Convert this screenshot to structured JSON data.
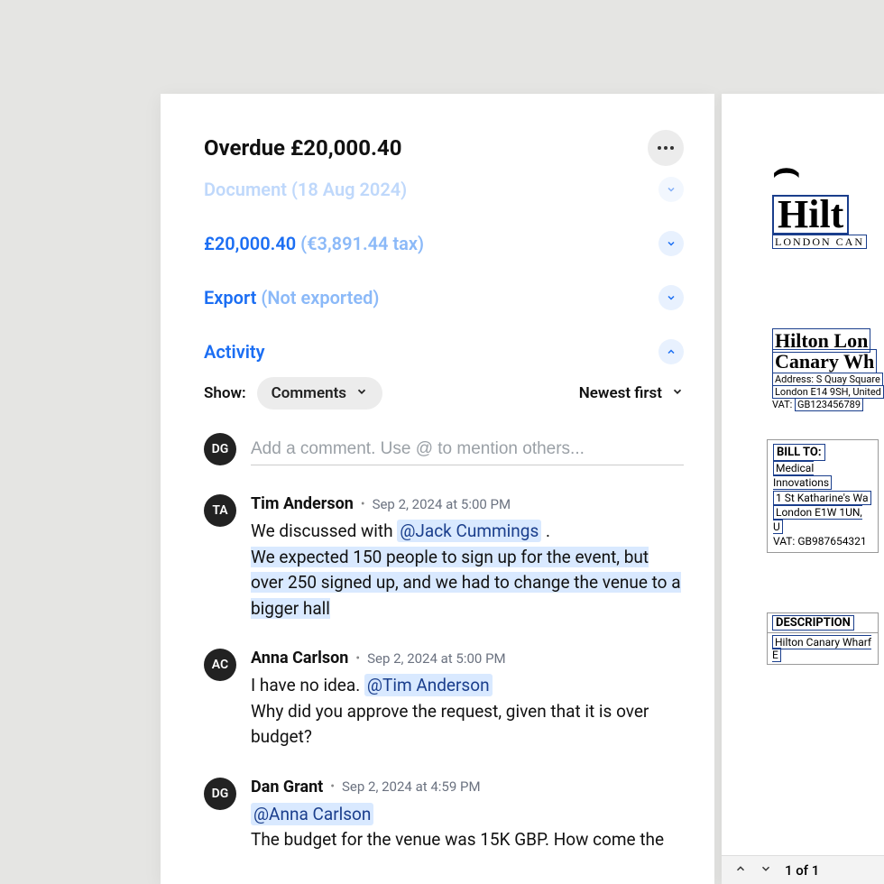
{
  "header": {
    "title": "Overdue £20,000.40"
  },
  "sections": {
    "document": {
      "label": "Document",
      "meta": "(18 Aug 2024)"
    },
    "amount": {
      "label": "£20,000.40",
      "meta": "(€3,891.44 tax)"
    },
    "export": {
      "label": "Export",
      "meta": "(Not exported)"
    },
    "activity": {
      "label": "Activity"
    }
  },
  "filters": {
    "show_label": "Show:",
    "show_value": "Comments",
    "sort": "Newest first"
  },
  "composer": {
    "avatar": "DG",
    "placeholder": "Add a comment. Use @ to mention others..."
  },
  "comments": [
    {
      "avatar": "TA",
      "author": "Tim Anderson",
      "time": "Sep 2, 2024 at 5:00 PM",
      "text_pre": "We discussed with ",
      "mention": "@Jack Cummings",
      "text_post": " .",
      "highlight": "We expected 150 people to sign up for the event, but over 250 signed up, and we had to change the venue to a bigger hall"
    },
    {
      "avatar": "AC",
      "author": "Anna Carlson",
      "time": "Sep 2, 2024 at 5:00 PM",
      "text_pre": "I have no idea. ",
      "mention": "@Tim Anderson",
      "line2": "Why did you approve the request, given that it is over budget?"
    },
    {
      "avatar": "DG",
      "author": "Dan Grant",
      "time": "Sep 2, 2024 at 4:59 PM",
      "mention": "@Anna Carlson",
      "line2": "The budget for the venue was 15K GBP. How come the"
    }
  ],
  "doc": {
    "brand": "Hilt",
    "brand_sub": "LONDON CAN",
    "heading1": "Hilton Lon",
    "heading2": "Canary Wh",
    "address1": "Address: S Quay Square",
    "address2": "London E14 9SH, United",
    "vat_label": "VAT:",
    "vat_val": "GB123456789",
    "bill_to_label": "BILL TO:",
    "bill_name": "Medical Innovations",
    "bill_addr1": "1 St Katharine's Wa",
    "bill_addr2": "London E1W 1UN, U",
    "bill_vat": "VAT: GB987654321",
    "desc_label": "DESCRIPTION",
    "desc_item": "Hilton Canary Wharf E"
  },
  "docbar": {
    "pages": "1 of 1"
  }
}
